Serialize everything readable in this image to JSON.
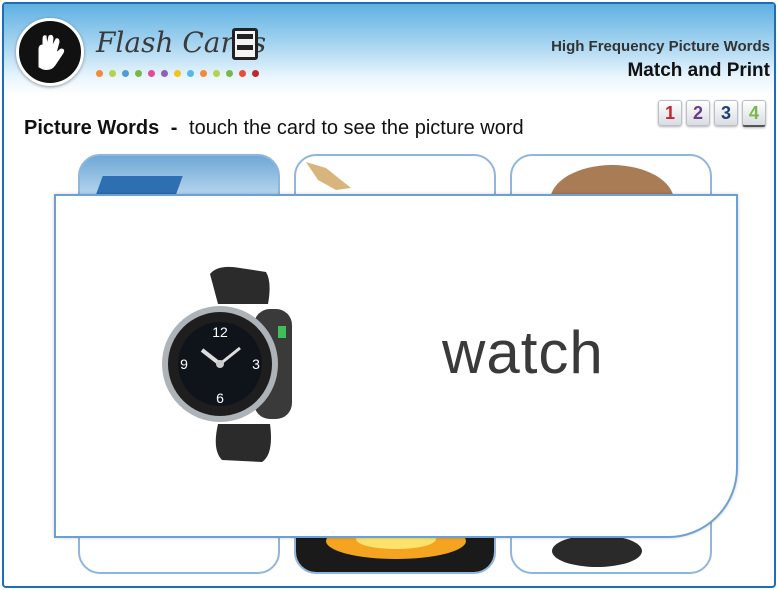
{
  "app": {
    "title": "Flash Cards"
  },
  "header": {
    "subtitle": "High Frequency Picture Words",
    "program": "Match and Print"
  },
  "pages": [
    "1",
    "2",
    "3",
    "4"
  ],
  "page_colors": [
    "#c2272d",
    "#6a3c8c",
    "#1f3e73",
    "#7ab648"
  ],
  "heading": {
    "label": "Picture Words",
    "separator": "-",
    "instruction": "touch the card to see the picture word"
  },
  "dot_colors": [
    "#f28a3a",
    "#b6d14b",
    "#4f9dd8",
    "#7ab648",
    "#e4499a",
    "#8e62b3",
    "#f0c419",
    "#54b9e6",
    "#f28a3a",
    "#b6d14b",
    "#7ab648",
    "#e74c3c",
    "#c2272d"
  ],
  "card": {
    "word": "watch"
  }
}
